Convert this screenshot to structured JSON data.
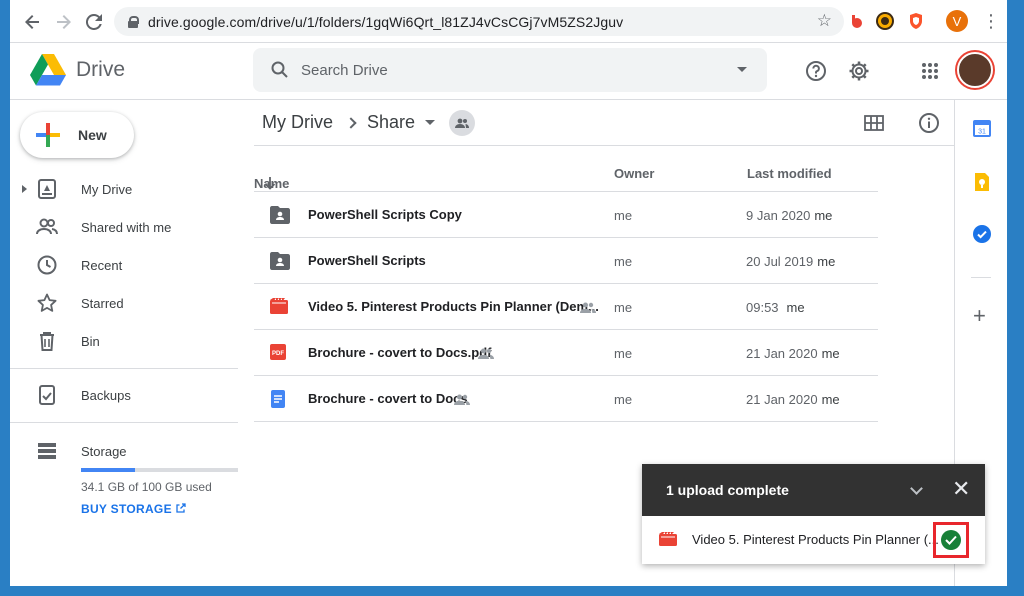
{
  "browser": {
    "url": "drive.google.com/drive/u/1/folders/1gqWi6Qrt_l81ZJ4vCsCGj7vM5ZS2Jguv",
    "profile_initial": "V"
  },
  "header": {
    "app_name": "Drive",
    "search_placeholder": "Search Drive"
  },
  "sidebar": {
    "new_label": "New",
    "items": [
      {
        "label": "My Drive",
        "icon": "my-drive-icon"
      },
      {
        "label": "Shared with me",
        "icon": "people-icon"
      },
      {
        "label": "Recent",
        "icon": "clock-icon"
      },
      {
        "label": "Starred",
        "icon": "star-icon"
      },
      {
        "label": "Bin",
        "icon": "trash-icon"
      },
      {
        "label": "Backups",
        "icon": "backup-icon"
      },
      {
        "label": "Storage",
        "icon": "storage-icon"
      }
    ],
    "storage_used_text": "34.1 GB of 100 GB used",
    "storage_fraction": 0.341,
    "buy_storage_label": "BUY STORAGE"
  },
  "breadcrumb": {
    "root": "My Drive",
    "current": "Share"
  },
  "table": {
    "columns": {
      "name": "Name",
      "owner": "Owner",
      "modified": "Last modified"
    },
    "rows": [
      {
        "type": "shared-folder",
        "name": "PowerShell Scripts Copy",
        "shared": false,
        "owner": "me",
        "modified": "9 Jan 2020",
        "modified_by": "me"
      },
      {
        "type": "shared-folder",
        "name": "PowerShell Scripts",
        "shared": false,
        "owner": "me",
        "modified": "20 Jul 2019",
        "modified_by": "me"
      },
      {
        "type": "video",
        "name": "Video 5. Pinterest Products Pin Planner (Dem...",
        "shared": true,
        "owner": "me",
        "modified": "09:53",
        "modified_by": "me"
      },
      {
        "type": "pdf",
        "name": "Brochure - covert to Docs.pdf",
        "shared": true,
        "owner": "me",
        "modified": "21 Jan 2020",
        "modified_by": "me"
      },
      {
        "type": "doc",
        "name": "Brochure - covert to Docs",
        "shared": true,
        "owner": "me",
        "modified": "21 Jan 2020",
        "modified_by": "me"
      }
    ]
  },
  "upload_toast": {
    "title": "1 upload complete",
    "file_name": "Video 5. Pinterest Products Pin Planner (..."
  },
  "colors": {
    "accent": "#1a73e8",
    "success": "#188038",
    "highlight_box": "#e8262c",
    "video": "#ea4335"
  }
}
